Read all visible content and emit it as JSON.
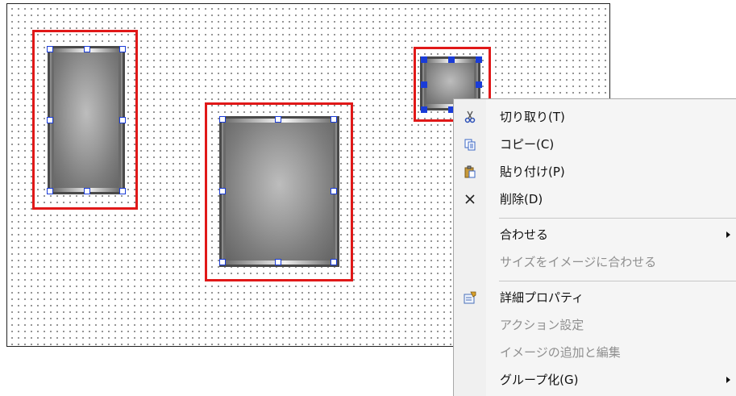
{
  "context_menu": {
    "cut": "切り取り(T)",
    "copy": "コピー(C)",
    "paste": "貼り付け(P)",
    "delete": "削除(D)",
    "align": "合わせる",
    "fit_to_image": "サイズをイメージに合わせる",
    "properties": "詳細プロパティ",
    "action_settings": "アクション設定",
    "image_add_edit": "イメージの追加と編集",
    "group": "グループ化(G)"
  },
  "colors": {
    "selection_red": "#e01818",
    "handle_blue": "#1a3cd8",
    "menu_bg": "#f5f5f5",
    "disabled_text": "#8f8f8f"
  }
}
